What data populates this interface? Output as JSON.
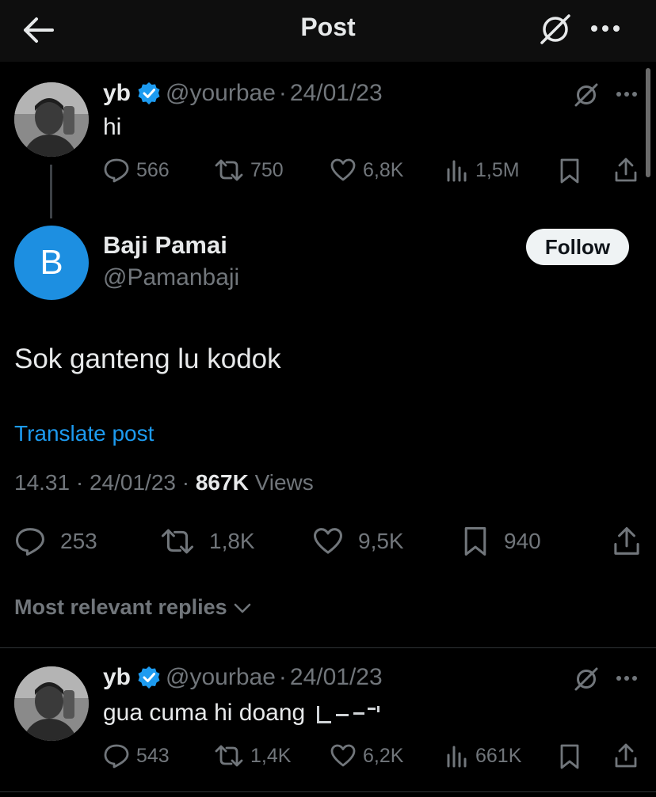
{
  "topbar": {
    "title": "Post",
    "back_icon": "arrow-left-icon",
    "grok_icon": "grok-icon",
    "more_icon": "more-icon"
  },
  "parent_post": {
    "name": "yb",
    "handle": "@yourbae",
    "separator": "·",
    "date": "24/01/23",
    "text": "hi",
    "replies": "566",
    "reposts": "750",
    "likes": "6,8K",
    "views": "1,5M"
  },
  "main_post": {
    "avatar_letter": "B",
    "name": "Baji Pamai",
    "handle": "@Pamanbaji",
    "follow_label": "Follow",
    "text": "Sok ganteng lu kodok",
    "translate_label": "Translate post",
    "time": "14.31",
    "separator": "·",
    "date": "24/01/23",
    "views_count": "867K",
    "views_label": "Views",
    "replies": "253",
    "reposts": "1,8K",
    "likes": "9,5K",
    "bookmarks": "940"
  },
  "replies_header": {
    "label": "Most relevant replies"
  },
  "reply_post": {
    "name": "yb",
    "handle": "@yourbae",
    "separator": "·",
    "date": "24/01/23",
    "text": "gua cuma hi doang",
    "replies": "543",
    "reposts": "1,4K",
    "likes": "6,2K",
    "views": "661K"
  },
  "colors": {
    "background": "#000000",
    "topbar": "#0e0e0e",
    "primary_text": "#e7e9ea",
    "secondary_text": "#71767b",
    "link": "#1d9bf0",
    "verified": "#1d9bf0",
    "avatar_b": "#1d8fe1"
  }
}
